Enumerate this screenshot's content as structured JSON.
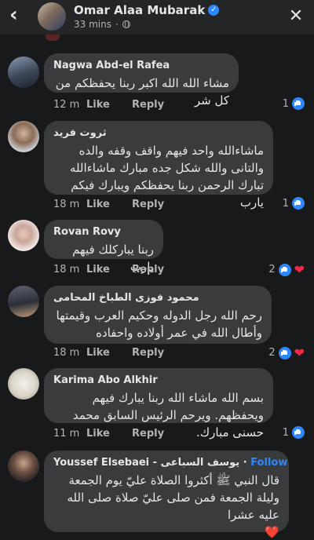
{
  "header": {
    "name": "Omar Alaa Mubarak",
    "time": "33 mins"
  },
  "comments": [
    {
      "author": "Nagwa Abd-el Rafea",
      "text": "مشاء الله  الله اكبر ربنا يحفظكم من كل شر",
      "time": "12 m",
      "like": "Like",
      "reply": "Reply",
      "reactions": "1"
    },
    {
      "author": "ثروت فريد",
      "text": "ماشاءالله واحد فيهم واقف وقفه والده والتانى والله شكل جده مبارك ماشاءالله تبارك الرحمن ربنا يحفظكم ويبارك فيكم يارب",
      "time": "18 m",
      "like": "Like",
      "reply": "Reply",
      "reactions": "1"
    },
    {
      "author": "Rovan Rovy",
      "text": "ربنا يباركلك فيهم يارب",
      "time": "18 m",
      "like": "Like",
      "reply": "Reply",
      "reactions": "2"
    },
    {
      "author": "محمود فوزى الطباخ المحامى",
      "text": "رحم الله رجل الدوله وحكيم العرب وقيمتها وأطال الله في عمر أولاده واحفاده",
      "time": "18 m",
      "like": "Like",
      "reply": "Reply",
      "reactions": "2"
    },
    {
      "author": "Karima Abo Alkhir",
      "text": "بسم الله ماشاء الله ربنا يبارك فيهم ويحفظهم. ويرحم الرئيس السابق محمد حسنى مبارك.",
      "time": "11 m",
      "like": "Like",
      "reply": "Reply",
      "reactions": "1"
    },
    {
      "author": "Youssef Elsebaei - يوسف السباعى",
      "follow": "Follow",
      "text": "قال النبي ﷺ أكثروا الصلاة عليّ يوم الجمعة وليلة الجمعة فمن صلى عليّ صلاة صلى الله عليه عشرا",
      "emoji": "❤️"
    }
  ]
}
